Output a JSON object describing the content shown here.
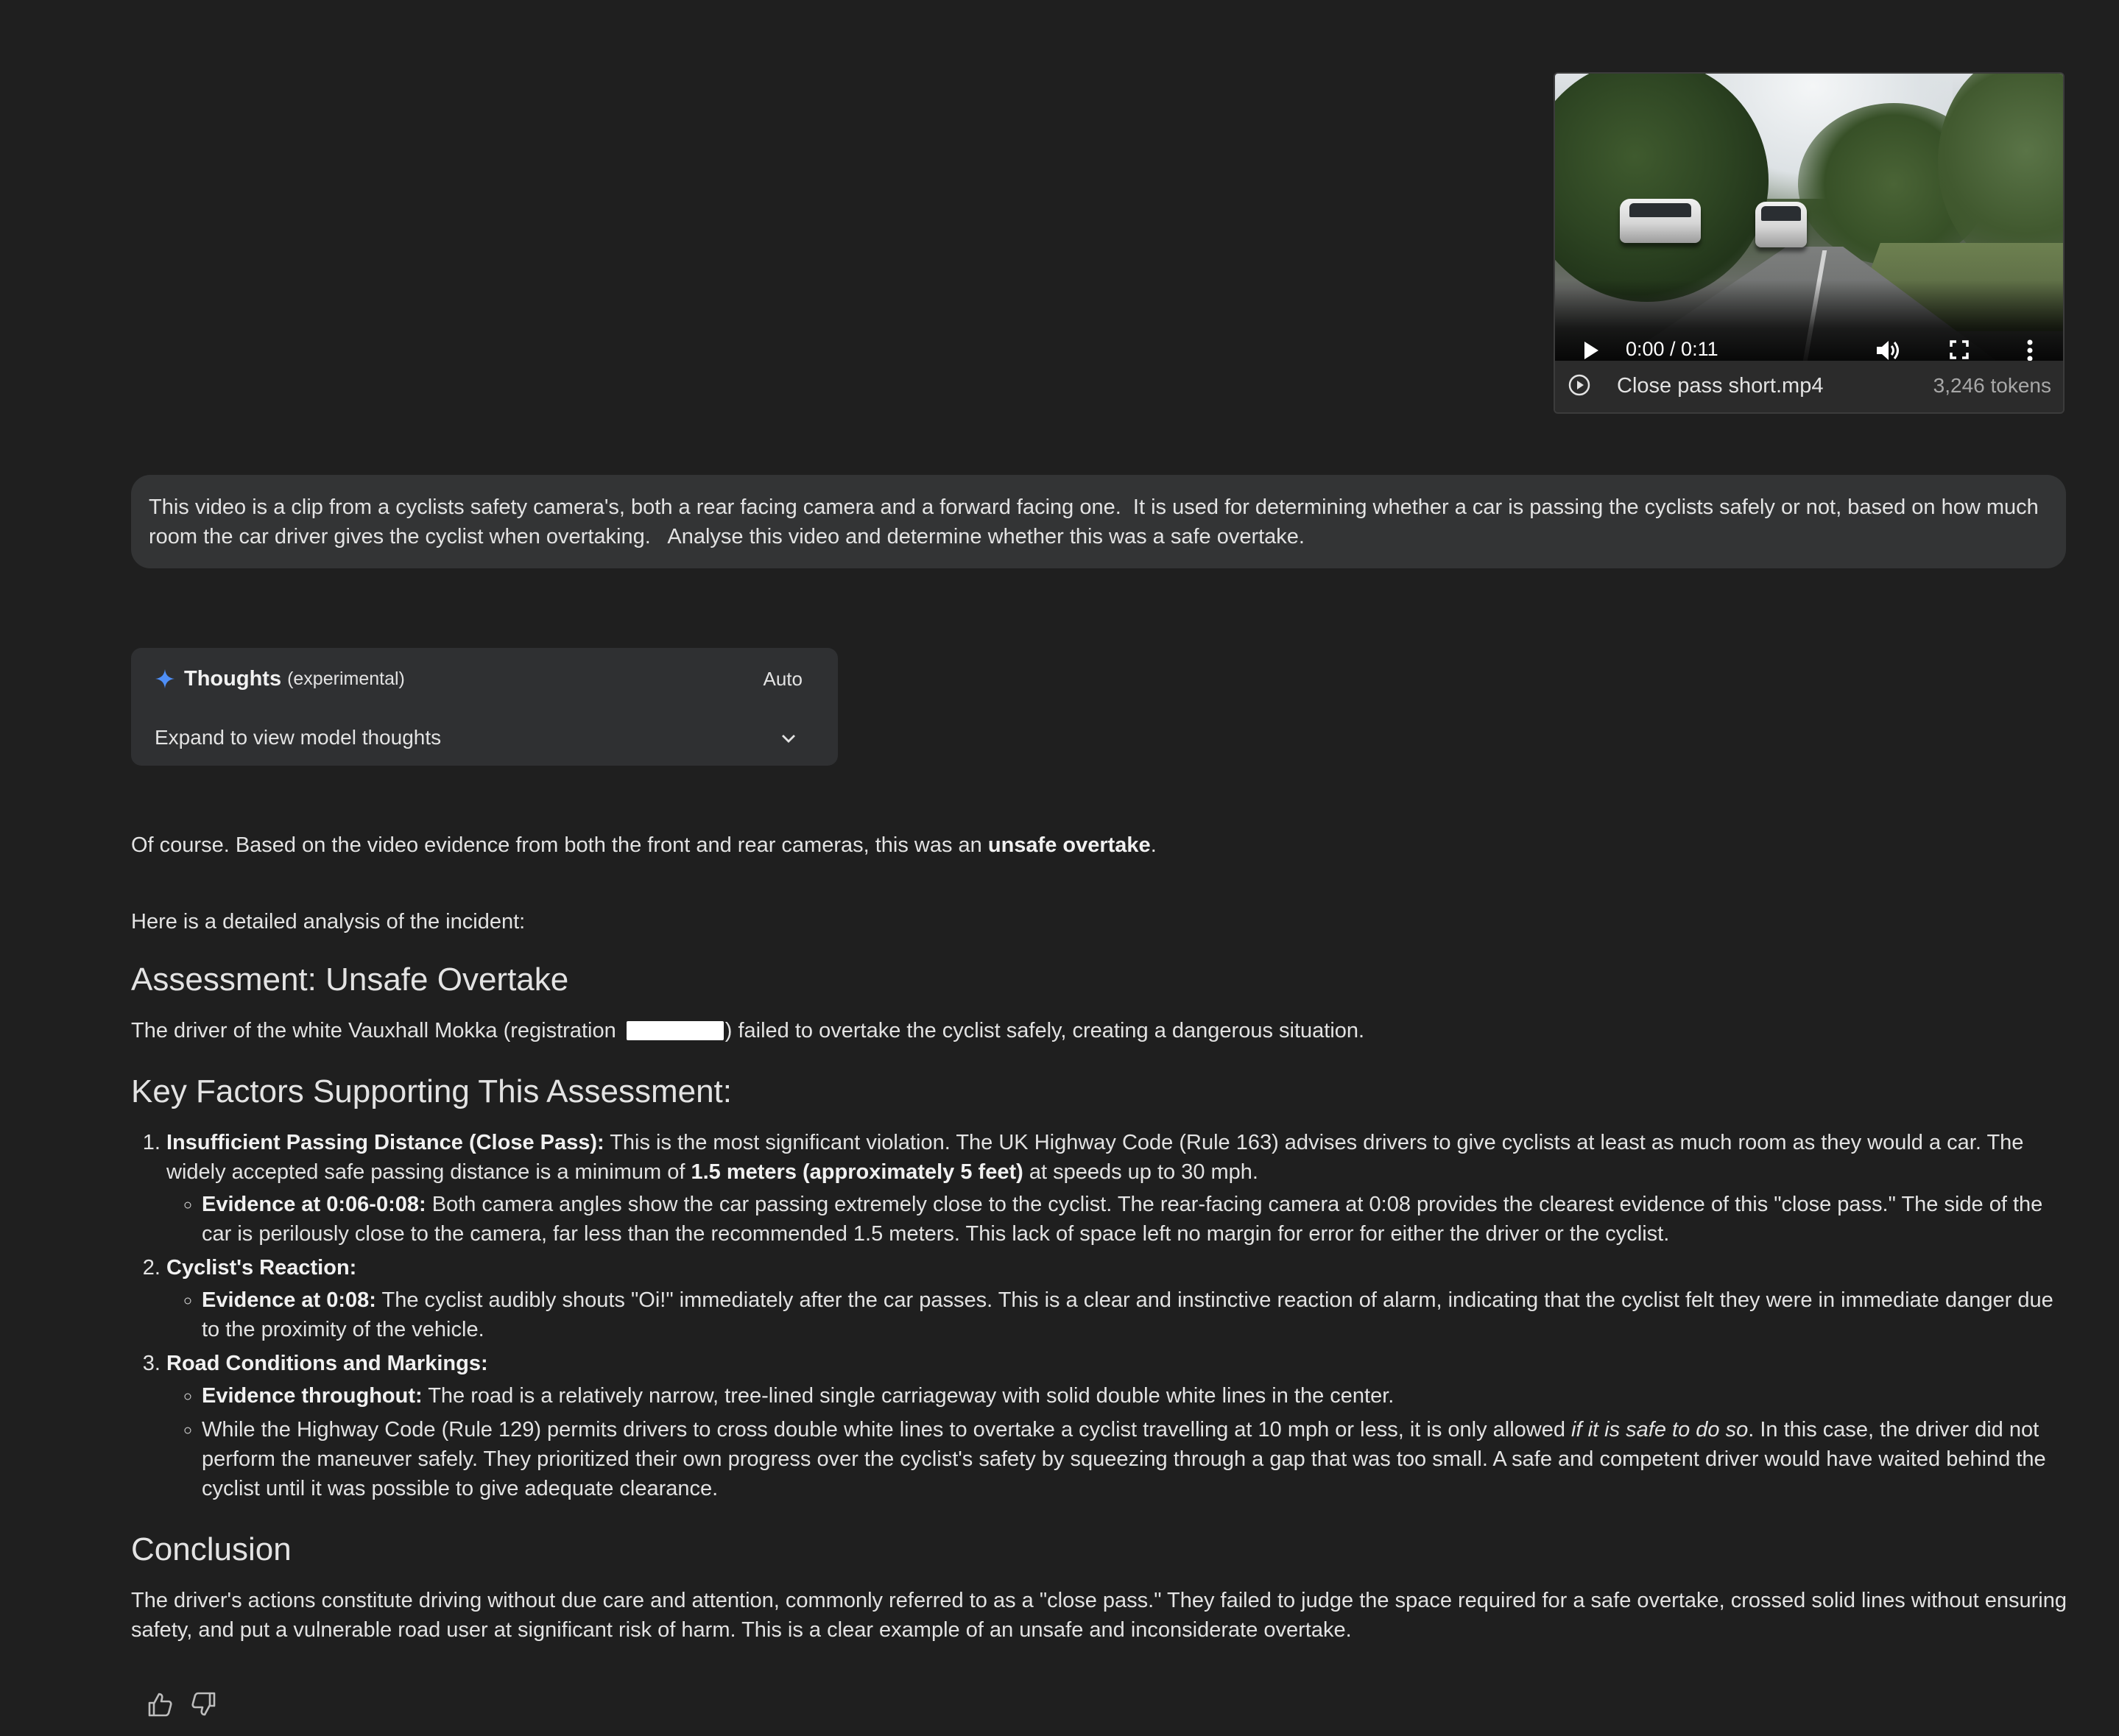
{
  "attachment": {
    "time": "0:00 / 0:11",
    "file_name": "Close pass short.mp4",
    "tokens": "3,246 tokens"
  },
  "prompt": {
    "text": "This video is a clip from a cyclists safety camera's, both a rear facing camera and a forward facing one.  It is used for determining whether a car is passing the cyclists safely or not, based on how much room the car driver gives the cyclist when overtaking.   Analyse this video and determine whether this was a safe overtake."
  },
  "thoughts": {
    "title": "Thoughts",
    "subtitle": "(experimental)",
    "mode": "Auto",
    "expand_label": "Expand to view model thoughts"
  },
  "response": {
    "intro_prefix": "Of course. Based on the video evidence from both the front and rear cameras, this was an ",
    "intro_bold": "unsafe overtake",
    "intro_suffix": ".",
    "detail_intro": "Here is a detailed analysis of the incident:",
    "assessment_heading": "Assessment: Unsafe Overtake",
    "assessment_prefix": "The driver of the white Vauxhall Mokka (registration ",
    "assessment_suffix": ") failed to overtake the cyclist safely, creating a dangerous situation.",
    "factors_heading": "Key Factors Supporting This Assessment:",
    "factors": [
      {
        "title": "Insufficient Passing Distance (Close Pass):",
        "text_before": " This is the most significant violation. The UK Highway Code (Rule 163) advises drivers to give cyclists at least as much room as they would a car. The widely accepted safe passing distance is a minimum of ",
        "text_bold": "1.5 meters (approximately 5 feet)",
        "text_after": " at speeds up to 30 mph.",
        "evidence": [
          {
            "label": "Evidence at 0:06-0:08:",
            "text": " Both camera angles show the car passing extremely close to the cyclist. The rear-facing camera at 0:08 provides the clearest evidence of this \"close pass.\" The side of the car is perilously close to the camera, far less than the recommended 1.5 meters. This lack of space left no margin for error for either the driver or the cyclist."
          }
        ]
      },
      {
        "title": "Cyclist's Reaction:",
        "evidence": [
          {
            "label": "Evidence at 0:08:",
            "text": " The cyclist audibly shouts \"Oi!\" immediately after the car passes. This is a clear and instinctive reaction of alarm, indicating that the cyclist felt they were in immediate danger due to the proximity of the vehicle."
          }
        ]
      },
      {
        "title": "Road Conditions and Markings:",
        "evidence": [
          {
            "label": "Evidence throughout:",
            "text": " The road is a relatively narrow, tree-lined single carriageway with solid double white lines in the center."
          },
          {
            "text_before": "While the Highway Code (Rule 129) permits drivers to cross double white lines to overtake a cyclist travelling at 10 mph or less, it is only allowed ",
            "text_italic": "if it is safe to do so",
            "text_after": ". In this case, the driver did not perform the maneuver safely. They prioritized their own progress over the cyclist's safety by squeezing through a gap that was too small. A safe and competent driver would have waited behind the cyclist until it was possible to give adequate clearance."
          }
        ]
      }
    ],
    "conclusion_heading": "Conclusion",
    "conclusion_text": "The driver's actions constitute driving without due care and attention, commonly referred to as a \"close pass.\" They failed to judge the space required for a safe overtake, crossed solid lines without ensuring safety, and put a vulnerable road user at significant risk of harm. This is a clear example of an unsafe and inconsiderate overtake."
  },
  "colors": {
    "background": "#1f1f1f",
    "bubble": "#333435",
    "panel": "#2f3032",
    "sparkle": "#4f8ff7",
    "text": "#e3e3e3"
  },
  "icons": [
    "play-icon",
    "volume-icon",
    "fullscreen-icon",
    "more-vert-icon",
    "play-circle-icon",
    "sparkle-icon",
    "chevron-down-icon",
    "thumbs-up-icon",
    "thumbs-down-icon"
  ]
}
